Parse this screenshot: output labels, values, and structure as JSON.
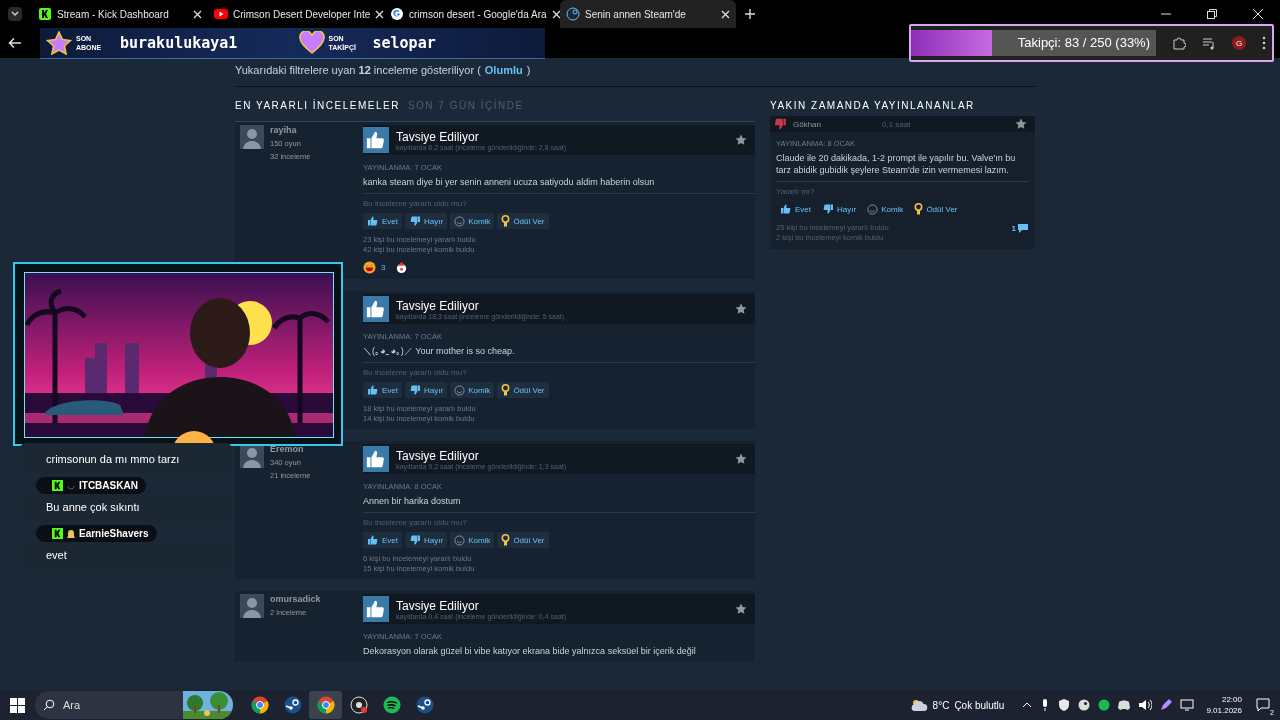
{
  "browser": {
    "tabs": [
      {
        "title": "Stream - Kick Dashboard",
        "kind": "kick",
        "selected": false
      },
      {
        "title": "Crimson Desert Developer Inte",
        "kind": "youtube",
        "selected": false
      },
      {
        "title": "crimson desert - Google'da Ara",
        "kind": "google",
        "selected": false
      },
      {
        "title": "Senin annen Steam'de",
        "kind": "steam",
        "selected": true
      }
    ],
    "profile_initial": "G"
  },
  "stream_overlay": {
    "alerts": [
      {
        "kind": "star",
        "label_top": "SON",
        "label_bottom": "ABONE",
        "name": "burakulukaya1"
      },
      {
        "kind": "heart",
        "label_top": "SON",
        "label_bottom": "TAKİPÇİ",
        "name": "selopar"
      }
    ],
    "goal": {
      "text": "Takipçi: 83 / 250 (33%)",
      "level": 0.33
    }
  },
  "filter_summary": {
    "text": "Yukarıdaki filtrelere uyan **12** inceleme gösteriliyor (",
    "link": "Olumlu",
    "end": ")"
  },
  "helpful": {
    "title": "EN YARARLI İNCELEMELER",
    "subtitle": "SON 7 GÜN İÇİNDE",
    "reviews": [
      {
        "author": {
          "name": "rayiha",
          "games": "150 oyun",
          "reviews": "32 inceleme"
        },
        "verdict": "Tavsiye Ediliyor",
        "recommended": true,
        "hours": "kayıtlarda 8,2 saat (inceleme gönderildiğinde: 2,8 saat)",
        "posted": "YAYINLANMA: 7 OCAK",
        "body": "kanka steam diye bi yer senin anneni ucuza satiyodu aldim haberin olsun",
        "prompt": "Bu inceleme yararlı oldu mu?",
        "buttons": [
          {
            "kind": "yes",
            "label": "Evet"
          },
          {
            "kind": "no",
            "label": "Hayır"
          },
          {
            "kind": "funny",
            "label": "Komik"
          },
          {
            "kind": "award",
            "label": "Ödül Ver"
          }
        ],
        "stats": [
          "23 kişi bu incelemeyi yararlı buldu",
          "42 kişi bu incelemeyi komik buldu"
        ],
        "awards": [
          {
            "kind": "laugh",
            "count": "3"
          },
          {
            "kind": "clown"
          }
        ]
      },
      {
        "verdict": "Tavsiye Ediliyor",
        "recommended": true,
        "hours": "kayıtlarda 18,3 saat (inceleme gönderildiğinde: 5 saat)",
        "posted": "YAYINLANMA: 7 OCAK",
        "body": "＼(｡◕‿◕｡)／ Your mother is so cheap.",
        "prompt": "Bu inceleme yararlı oldu mu?",
        "buttons": [
          {
            "kind": "yes",
            "label": "Evet"
          },
          {
            "kind": "no",
            "label": "Hayır"
          },
          {
            "kind": "funny",
            "label": "Komik"
          },
          {
            "kind": "award",
            "label": "Ödül Ver"
          }
        ],
        "stats": [
          "18 kişi bu incelemeyi yararlı buldu",
          "14 kişi bu incelemeyi komik buldu"
        ]
      },
      {
        "author": {
          "name": "Eremon",
          "games": "340 oyun",
          "reviews": "21 inceleme"
        },
        "verdict": "Tavsiye Ediliyor",
        "recommended": true,
        "hours": "kayıtlarda 9,2 saat (inceleme gönderildiğinde: 1,3 saat)",
        "posted": "YAYINLANMA: 8 OCAK",
        "body": "Annen bir harika dostum",
        "prompt": "Bu inceleme yararlı oldu mu?",
        "buttons": [
          {
            "kind": "yes",
            "label": "Evet"
          },
          {
            "kind": "no",
            "label": "Hayır"
          },
          {
            "kind": "funny",
            "label": "Komik"
          },
          {
            "kind": "award",
            "label": "Ödül Ver"
          }
        ],
        "stats": [
          "6 kişi bu incelemeyi yararlı buldu",
          "15 kişi bu incelemeyi komik buldu"
        ]
      },
      {
        "author": {
          "name": "omursadick",
          "reviews": "2 inceleme"
        },
        "verdict": "Tavsiye Ediliyor",
        "recommended": true,
        "hours": "kayıtlarda 0,4 saat (inceleme gönderildiğinde: 0,4 saat)",
        "posted": "YAYINLANMA: 7 OCAK",
        "body": "Dekorasyon olarak güzel bi vibe katıyor ekrana bide yalnızca seksüel bir içerik değil"
      }
    ]
  },
  "recent": {
    "title": "YAKIN ZAMANDA YAYINLANANLAR",
    "reviews": [
      {
        "author": {
          "name": "Gökhan"
        },
        "recommended": false,
        "hours": "0,1 saat",
        "posted": "YAYINLANMA: 8 OCAK",
        "body": "Claude ile 20 dakikada, 1-2 prompt ile yapılır bu. Valve'ın bu tarz abidik gubidik şeylere Steam'de izin vermemesi lazım.",
        "prompt": "Yararlı mı?",
        "buttons": [
          {
            "kind": "yes",
            "label": "Evet"
          },
          {
            "kind": "no",
            "label": "Hayır"
          },
          {
            "kind": "funny",
            "label": "Komik"
          },
          {
            "kind": "award",
            "label": "Ödül Ver"
          }
        ],
        "stats": [
          "25 kişi bu incelemeyi yararlı buldu",
          "2 kişi bu incelemeyi komik buldu"
        ],
        "comments": "1"
      }
    ]
  },
  "chat": {
    "partial": "crimsonun da mı mmo tarzı",
    "messages": [
      {
        "user": "ITCBASKAN",
        "kind": "smile",
        "text": "Bu anne çok sıkıntı"
      },
      {
        "user": "EarnieShavers",
        "kind": "bell",
        "text": "evet"
      }
    ]
  },
  "taskbar": {
    "search": {
      "placeholder": "Ara"
    },
    "apps": [
      {
        "kind": "chrome",
        "selected": false
      },
      {
        "kind": "steam",
        "selected": false
      },
      {
        "kind": "chrome",
        "selected": true
      },
      {
        "kind": "obs",
        "selected": false
      },
      {
        "kind": "spotify",
        "selected": false
      },
      {
        "kind": "steam",
        "selected": false
      }
    ],
    "weather": {
      "temp": "8°C",
      "text": "Çok bulutlu"
    },
    "time": "22:00",
    "date": "9.01.2026",
    "notifications": "2"
  }
}
